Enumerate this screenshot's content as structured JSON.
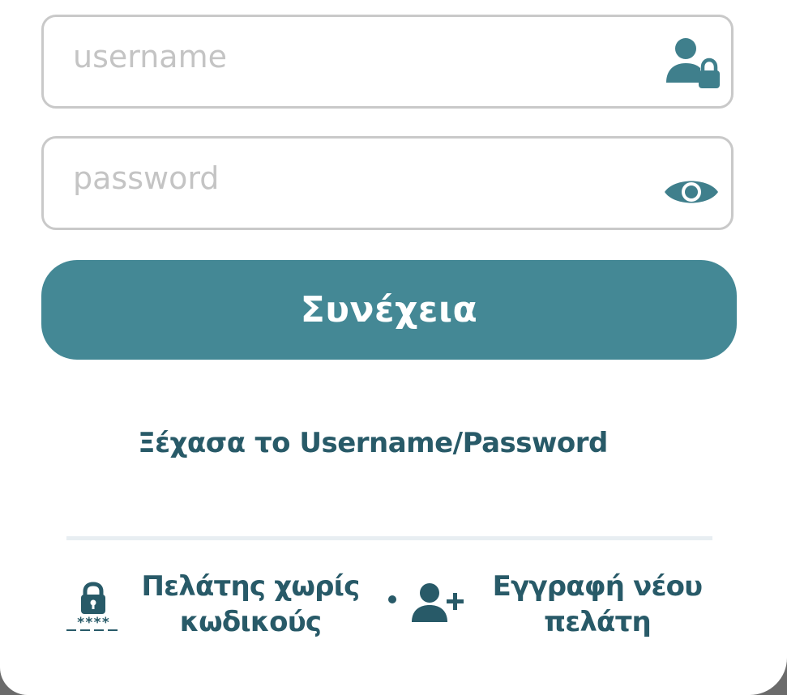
{
  "login": {
    "username_placeholder": "username",
    "password_placeholder": "password",
    "continue_label": "Συνέχεια",
    "forgot_label": "Ξέχασα το Username/Password"
  },
  "options": {
    "no_codes_label": "Πελάτης χωρίς\nκωδικούς",
    "register_label": "Εγγραφή νέου\nπελάτη"
  },
  "icons": {
    "username_field": "user-lock-icon",
    "password_field": "eye-icon",
    "no_codes": "lock-stars-icon",
    "register": "user-plus-icon"
  },
  "colors": {
    "accent": "#448895",
    "text_dark": "#285a68",
    "icon": "#3f7f8c",
    "field_border": "#c9c9c9",
    "placeholder": "#c4c4c4"
  }
}
